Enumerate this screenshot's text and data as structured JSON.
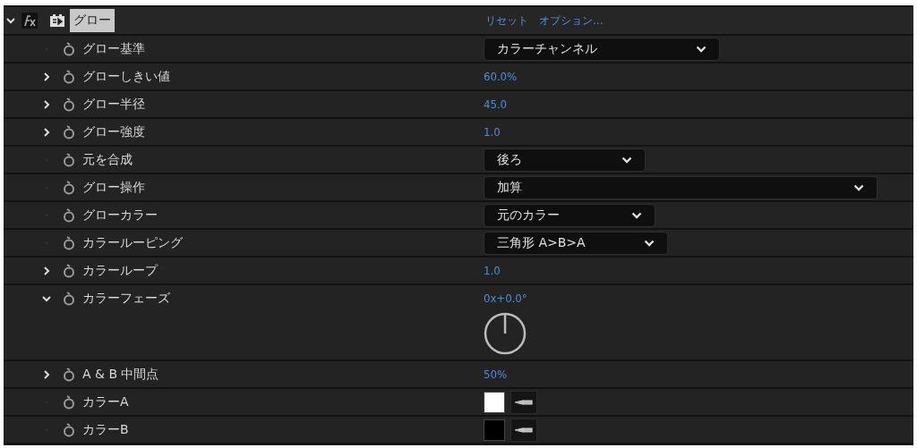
{
  "effect": {
    "name": "グロー",
    "expanded": true,
    "selected": true,
    "links": [
      "リセット",
      "オプション..."
    ]
  },
  "properties": [
    {
      "name": "グロー基準",
      "kind": "dropdown",
      "value": "カラーチャンネル"
    },
    {
      "name": "グローしきい値",
      "kind": "number",
      "expanded": false,
      "value": "60.0%"
    },
    {
      "name": "グロー半径",
      "kind": "number",
      "expanded": false,
      "value": "45.0"
    },
    {
      "name": "グロー強度",
      "kind": "number",
      "expanded": false,
      "value": "1.0"
    },
    {
      "name": "元を合成",
      "kind": "dropdown",
      "value": "後ろ"
    },
    {
      "name": "グロー操作",
      "kind": "dropdown",
      "value": "加算"
    },
    {
      "name": "グローカラー",
      "kind": "dropdown",
      "value": "元のカラー"
    },
    {
      "name": "カラールーピング",
      "kind": "dropdown",
      "value": "三角形 A>B>A"
    },
    {
      "name": "カラーループ",
      "kind": "number",
      "expanded": false,
      "value": "1.0"
    },
    {
      "name": "カラーフェーズ",
      "kind": "angle",
      "expanded": true,
      "value": "0x+0.0°"
    },
    {
      "name": "A & B 中間点",
      "kind": "number",
      "expanded": false,
      "value": "50%"
    },
    {
      "name": "カラーA",
      "kind": "color",
      "color": "#ffffff"
    },
    {
      "name": "カラーB",
      "kind": "color",
      "color": "#000000"
    }
  ]
}
